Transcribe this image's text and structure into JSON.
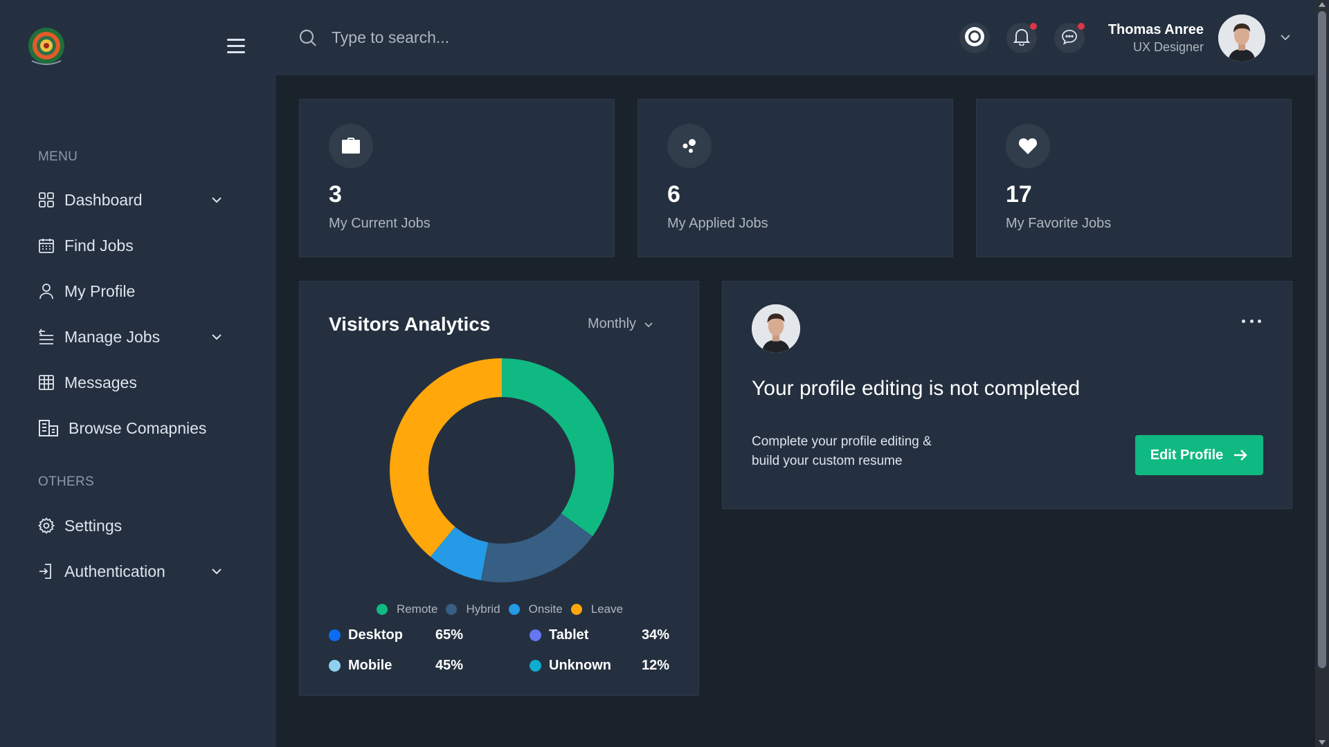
{
  "sidebar": {
    "menu_heading": "MENU",
    "others_heading": "OTHERS",
    "items": [
      {
        "label": "Dashboard",
        "icon": "grid-icon",
        "has_dropdown": true
      },
      {
        "label": "Find Jobs",
        "icon": "calendar-icon",
        "has_dropdown": false
      },
      {
        "label": "My Profile",
        "icon": "user-icon",
        "has_dropdown": false
      },
      {
        "label": "Manage Jobs",
        "icon": "list-icon",
        "has_dropdown": true
      },
      {
        "label": "Messages",
        "icon": "table-icon",
        "has_dropdown": false
      },
      {
        "label": "Browse Comapnies",
        "icon": "building-icon",
        "has_dropdown": false
      }
    ],
    "other_items": [
      {
        "label": "Settings",
        "icon": "gear-icon",
        "has_dropdown": false
      },
      {
        "label": "Authentication",
        "icon": "login-icon",
        "has_dropdown": true
      }
    ]
  },
  "header": {
    "search_placeholder": "Type to search...",
    "user_name": "Thomas Anree",
    "user_role": "UX Designer"
  },
  "stats": [
    {
      "value": "3",
      "label": "My Current Jobs",
      "icon": "briefcase-icon"
    },
    {
      "value": "6",
      "label": "My Applied Jobs",
      "icon": "dots-icon"
    },
    {
      "value": "17",
      "label": "My Favorite Jobs",
      "icon": "heart-icon"
    }
  ],
  "analytics": {
    "title": "Visitors Analytics",
    "period": "Monthly",
    "devices": [
      {
        "name": "Desktop",
        "pct": "65%",
        "color": "#0c6cf2"
      },
      {
        "name": "Tablet",
        "pct": "34%",
        "color": "#6577f3"
      },
      {
        "name": "Mobile",
        "pct": "45%",
        "color": "#8fd0ef"
      },
      {
        "name": "Unknown",
        "pct": "12%",
        "color": "#0fadcf"
      }
    ]
  },
  "chart_data": {
    "type": "pie",
    "title": "",
    "categories": [
      "Remote",
      "Hybrid",
      "Onsite",
      "Leave"
    ],
    "values": [
      35,
      18,
      8,
      39
    ],
    "colors": [
      "#10b981",
      "#375e83",
      "#259ae6",
      "#ffa70b"
    ],
    "legend_position": "bottom"
  },
  "profile_card": {
    "title": "Your profile editing is not completed",
    "desc_line1": "Complete your profile editing &",
    "desc_line2": "build your custom resume",
    "button_label": "Edit Profile"
  }
}
